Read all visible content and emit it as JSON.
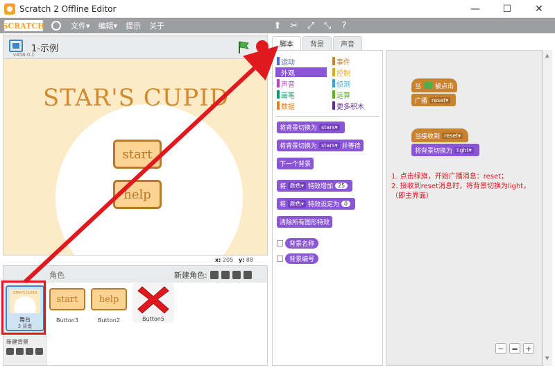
{
  "window": {
    "title": "Scratch 2 Offline Editor",
    "minimize": "—",
    "maximize": "☐",
    "close": "✕"
  },
  "menubar": {
    "logo": "SCRATCH",
    "items": [
      "文件▾",
      "编辑▾",
      "提示",
      "关于"
    ]
  },
  "stage": {
    "project_name": "1-示例",
    "version": "v458.0.1",
    "title": "STAR'S CUPID",
    "btn_start": "start",
    "btn_help": "help",
    "coords_x_label": "x:",
    "coords_x": "205",
    "coords_y_label": "y:",
    "coords_y": "88"
  },
  "sprites": {
    "header_label": "角色",
    "new_sprite_label": "新建角色:",
    "stage_thumb": {
      "title": "STAR'S CUPID",
      "label": "舞台",
      "sub": "3 背景"
    },
    "new_background_label": "新建背景",
    "items": [
      {
        "thumb": "start",
        "name": "Button3"
      },
      {
        "thumb": "help",
        "name": "Button2"
      },
      {
        "thumb": "",
        "name": "Button5"
      }
    ]
  },
  "tabs": [
    "脚本",
    "背景",
    "声音"
  ],
  "categories": {
    "left": [
      {
        "label": "运动",
        "color": "#4a6cd4"
      },
      {
        "label": "外观",
        "color": "#8a55d7"
      },
      {
        "label": "声音",
        "color": "#bb42c3"
      },
      {
        "label": "画笔",
        "color": "#0e9a6c"
      },
      {
        "label": "数据",
        "color": "#ee7d16"
      }
    ],
    "right": [
      {
        "label": "事件",
        "color": "#c88330"
      },
      {
        "label": "控制",
        "color": "#e1a91a"
      },
      {
        "label": "侦测",
        "color": "#2ca5e2"
      },
      {
        "label": "运算",
        "color": "#5cb712"
      },
      {
        "label": "更多积木",
        "color": "#632d99"
      }
    ]
  },
  "palette_blocks": {
    "switch_bg": "将背景切换为",
    "switch_bg_val": "stars▾",
    "switch_bg_wait": "将背景切换为",
    "switch_bg_wait_val": "stars▾",
    "switch_bg_wait_suffix": "并等待",
    "next_bg": "下一个背景",
    "change_effect_a": "将",
    "change_effect_dd": "颜色▾",
    "change_effect_b": "特效增加",
    "change_effect_n": "25",
    "set_effect_a": "将",
    "set_effect_dd": "颜色▾",
    "set_effect_b": "特效设定为",
    "set_effect_n": "0",
    "clear_effects": "清除所有图形特效",
    "bg_name": "背景名称",
    "bg_number": "背景编号"
  },
  "scripts": {
    "when_flag_a": "当",
    "when_flag_b": "被点击",
    "broadcast": "广播",
    "broadcast_val": "reset▾",
    "when_receive": "当接收到",
    "when_receive_val": "reset▾",
    "switch_to": "将背景切换为",
    "switch_to_val": "light▾"
  },
  "annotation": {
    "line1": "1. 点击绿旗，开始广播消息：reset；",
    "line2": "2. 接收到reset消息时，将背景切换为light，",
    "line3": "（即主界面）"
  },
  "zoom": {
    "out": "−",
    "reset": "=",
    "in": "+"
  },
  "colors": {
    "accent": "#8a55d7",
    "event": "#c88330",
    "annotation": "#e0191f"
  }
}
